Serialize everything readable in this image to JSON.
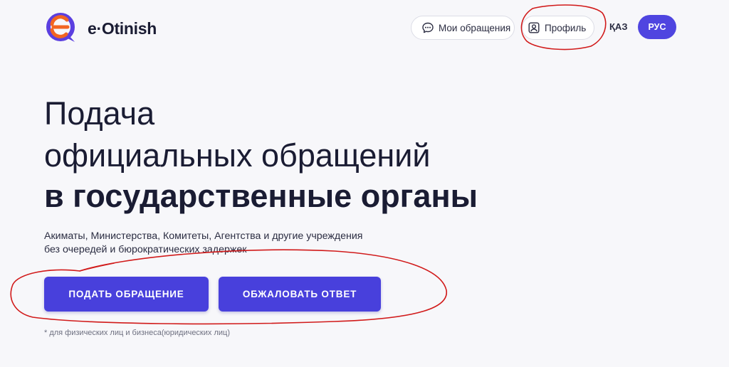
{
  "header": {
    "logo_text": "e·Otinish",
    "my_requests_label": "Мои обращения",
    "profile_label": "Профиль",
    "lang_kaz": "ҚАЗ",
    "lang_rus": "РУС"
  },
  "hero": {
    "line1": "Подача",
    "line2": "официальных обращений",
    "line3": "в государственные органы"
  },
  "subtitle": {
    "line1": "Акиматы, Министерства, Комитеты, Агентства и другие учреждения",
    "line2": "без очередей и бюрократических задержек"
  },
  "buttons": {
    "submit": "ПОДАТЬ ОБРАЩЕНИЕ",
    "appeal": "ОБЖАЛОВАТЬ ОТВЕТ"
  },
  "footnote": "* для физических лиц и бизнеса(юридических лиц)",
  "colors": {
    "accent": "#4840dc",
    "logo_orange": "#f26522",
    "logo_purple": "#5b3fe0",
    "annotation_red": "#d11a1a",
    "background": "#f7f7fa"
  },
  "icons": {
    "logo": "e-otinish-logo-icon",
    "chat": "chat-bubble-icon",
    "profile": "user-profile-icon"
  }
}
